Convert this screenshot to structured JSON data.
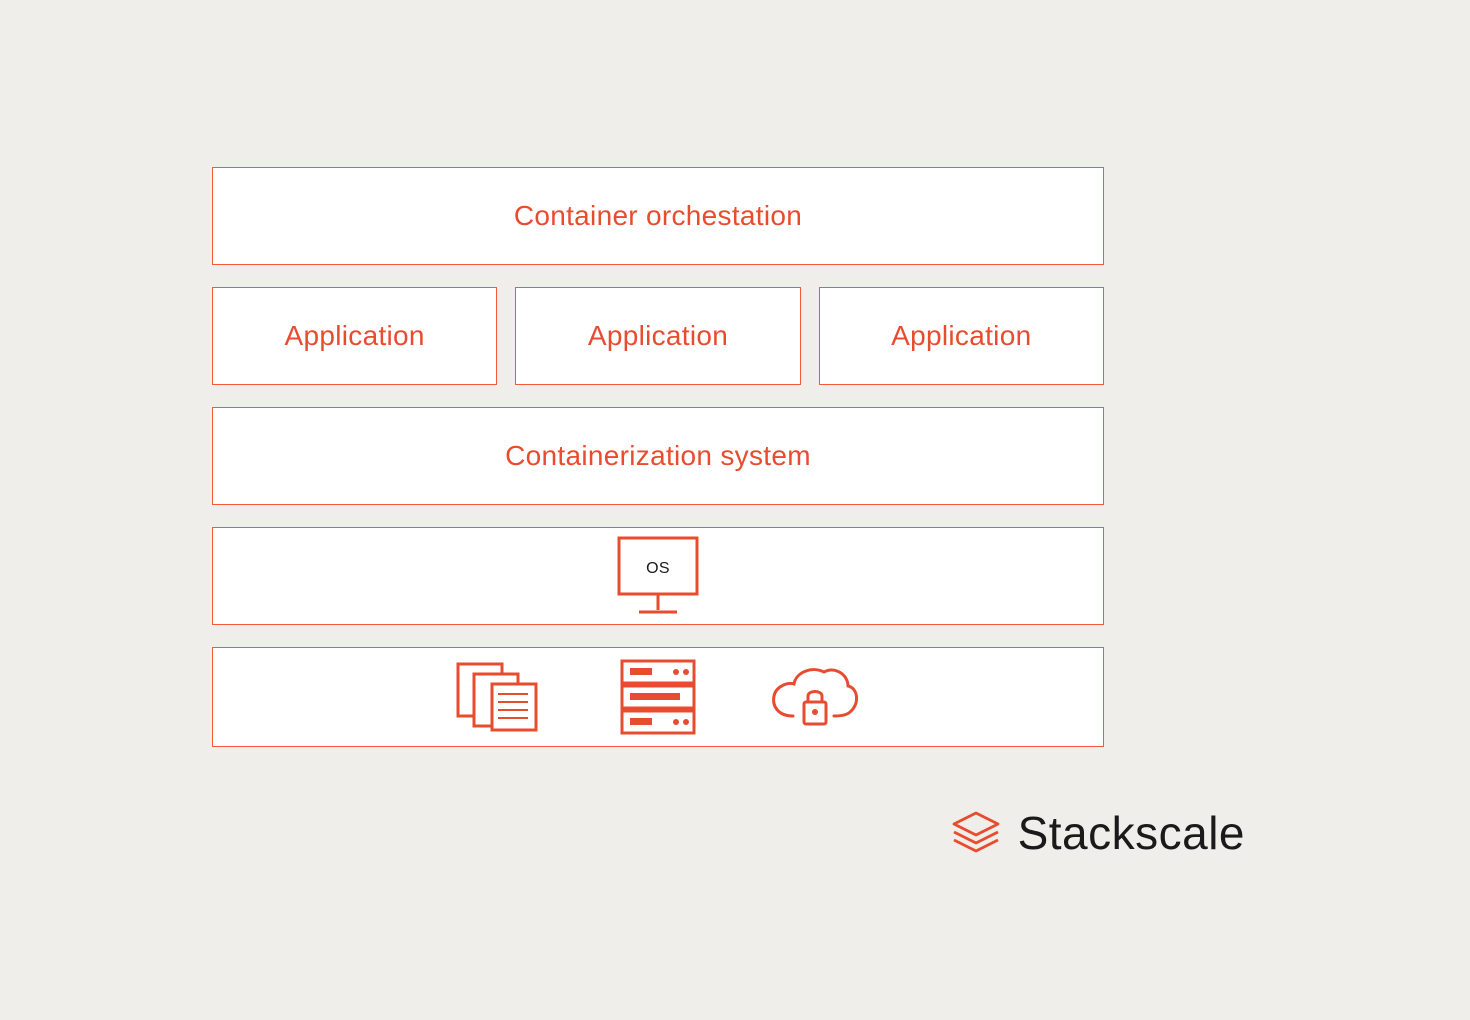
{
  "diagram": {
    "layers": {
      "orchestration": {
        "label": "Container orchestation"
      },
      "applications": [
        {
          "label": "Application"
        },
        {
          "label": "Application"
        },
        {
          "label": "Application"
        }
      ],
      "containerization": {
        "label": "Containerization system"
      },
      "os": {
        "label": "OS",
        "icon": "monitor-icon"
      },
      "infrastructure": {
        "icons": [
          "servers-icon",
          "rack-icon",
          "cloud-lock-icon"
        ]
      }
    }
  },
  "branding": {
    "name": "Stackscale",
    "icon": "stackscale-logo-icon"
  },
  "colors": {
    "accent": "#e84c2f",
    "border": "#f25b3a",
    "background": "#efeeeb",
    "box": "#ffffff",
    "logo_text": "#1a1a1a"
  }
}
